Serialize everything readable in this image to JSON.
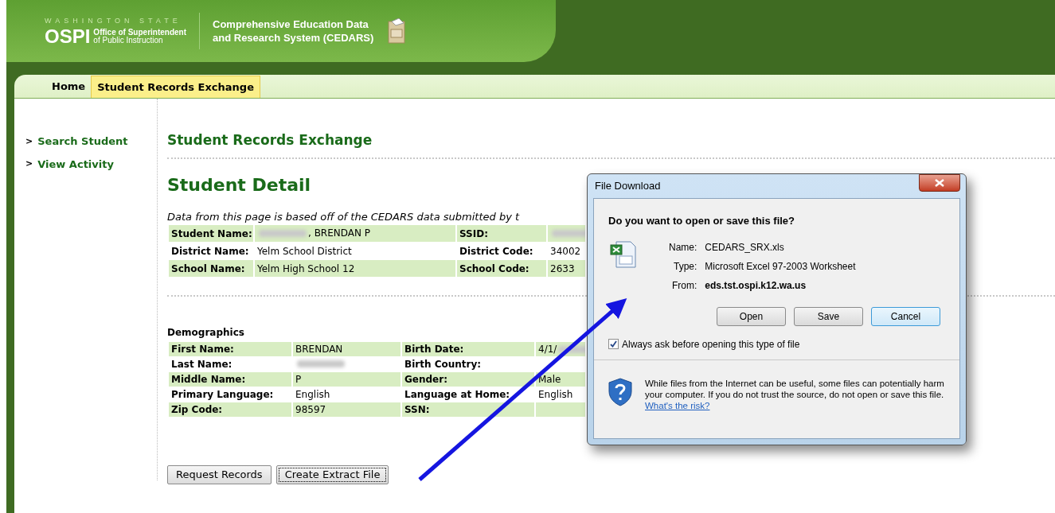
{
  "header": {
    "state_label": "WASHINGTON STATE",
    "logo": "OSPI",
    "agency": "Office of Superintendent",
    "agency_line2": "of Public Instruction",
    "system_title": "Comprehensive Education Data",
    "system_title_line2": "and Research System (CEDARS)"
  },
  "nav_tabs": [
    {
      "label": "Home",
      "selected": false
    },
    {
      "label": "Student Records Exchange",
      "selected": true
    }
  ],
  "sidebar": {
    "items": [
      {
        "marker": ">",
        "label": "Search Student"
      },
      {
        "marker": ">",
        "label": "View Activity"
      }
    ]
  },
  "page_title": "Student Records Exchange",
  "section_title": "Student Detail",
  "note": "Data from this page is based off of the CEDARS data submitted by t",
  "student_table": {
    "rows": [
      {
        "cells": [
          {
            "kind": "label",
            "text": "Student Name:"
          },
          {
            "kind": "value",
            "redacted": true,
            "text": ", BRENDAN P"
          },
          {
            "kind": "label",
            "text": "SSID:"
          },
          {
            "kind": "value",
            "redacted": true
          }
        ]
      },
      {
        "cells": [
          {
            "kind": "label",
            "text": "District Name:"
          },
          {
            "kind": "value",
            "redacted": false,
            "text": "Yelm School District"
          },
          {
            "kind": "label",
            "text": "District Code:"
          },
          {
            "kind": "value",
            "redacted": false,
            "text": "34002"
          }
        ]
      },
      {
        "cells": [
          {
            "kind": "label",
            "text": "School Name:"
          },
          {
            "kind": "value",
            "redacted": false,
            "text": "Yelm High School 12"
          },
          {
            "kind": "label",
            "text": "School Code:"
          },
          {
            "kind": "value",
            "redacted": false,
            "text": "2633"
          }
        ]
      }
    ]
  },
  "demographics": {
    "title": "Demographics",
    "rows": [
      {
        "cells": [
          {
            "kind": "label",
            "text": "First Name:"
          },
          {
            "kind": "value",
            "redacted": false,
            "text": "BRENDAN"
          },
          {
            "kind": "label",
            "text": "Birth Date:"
          },
          {
            "kind": "value",
            "redacted": true,
            "text": "4/1/",
            "text_first": true
          }
        ]
      },
      {
        "cells": [
          {
            "kind": "label",
            "text": "Last Name:"
          },
          {
            "kind": "value",
            "redacted": true
          },
          {
            "kind": "label",
            "text": "Birth Country:"
          },
          {
            "kind": "value",
            "redacted": false
          }
        ]
      },
      {
        "cells": [
          {
            "kind": "label",
            "text": "Middle Name:"
          },
          {
            "kind": "value",
            "redacted": false,
            "text": "P"
          },
          {
            "kind": "label",
            "text": "Gender:"
          },
          {
            "kind": "value",
            "redacted": false,
            "text": "Male"
          }
        ]
      },
      {
        "cells": [
          {
            "kind": "label",
            "text": "Primary Language:"
          },
          {
            "kind": "value",
            "redacted": false,
            "text": "English"
          },
          {
            "kind": "label",
            "text": "Language at Home:"
          },
          {
            "kind": "value",
            "redacted": false,
            "text": "English"
          }
        ]
      },
      {
        "cells": [
          {
            "kind": "label",
            "text": "Zip Code:"
          },
          {
            "kind": "value",
            "redacted": false,
            "text": "98597"
          },
          {
            "kind": "label",
            "text": "SSN:"
          },
          {
            "kind": "value",
            "redacted": false
          }
        ]
      }
    ]
  },
  "buttons": [
    {
      "label": "Request Records",
      "focused": false
    },
    {
      "label": "Create Extract File",
      "focused": true
    }
  ],
  "dialog": {
    "title": "File Download",
    "question": "Do you want to open or save this file?",
    "fields": [
      {
        "label": "Name:",
        "value": "CEDARS_SRX.xls",
        "bold": false
      },
      {
        "label": "Type:",
        "value": "Microsoft Excel 97-2003 Worksheet",
        "bold": false
      },
      {
        "label": "From:",
        "value": "eds.tst.ospi.k12.wa.us",
        "bold": true
      }
    ],
    "buttons": [
      {
        "label": "Open",
        "default": false
      },
      {
        "label": "Save",
        "default": false
      },
      {
        "label": "Cancel",
        "default": true
      }
    ],
    "checkbox": {
      "label": "Always ask before opening this type of file",
      "checked": true
    },
    "warning": "While files from the Internet can be useful, some files can potentially harm your computer. If you do not trust the source, do not open or save this file.",
    "warning_link": "What's the risk?"
  }
}
